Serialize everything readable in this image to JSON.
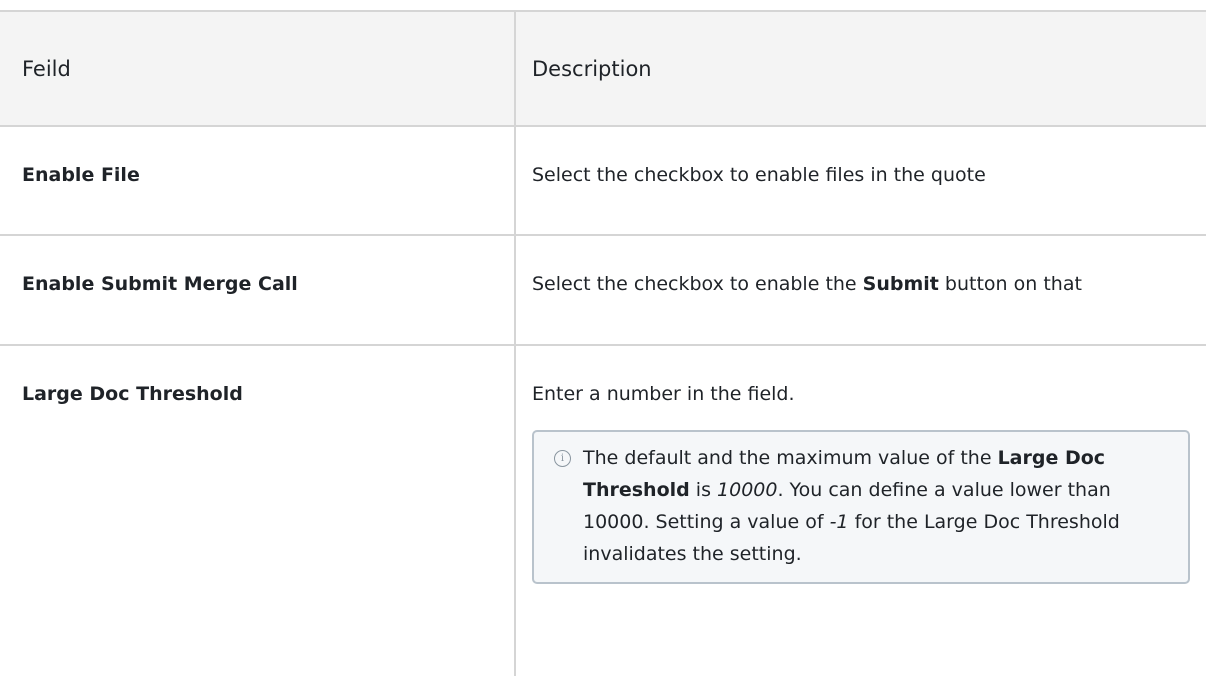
{
  "table": {
    "headers": {
      "field": "Feild",
      "description": "Description"
    },
    "rows": [
      {
        "field": "Enable File",
        "description": "Select the checkbox to enable files in the quote"
      },
      {
        "field": "Enable Submit Merge Call",
        "desc_pre": "Select the checkbox to enable the ",
        "desc_bold": "Submit",
        "desc_post": " button on that"
      },
      {
        "field": "Large Doc Threshold",
        "description": "Enter a number in the field."
      }
    ],
    "note": {
      "icon": "info-icon",
      "t1": "The default and the maximum value of the ",
      "b1": "Large Doc Threshold",
      "t2": " is ",
      "i1": "10000",
      "t3": ". You can define a value lower than 10000. Setting a value of ",
      "i2": "-1",
      "t4": " for the Large Doc Threshold invalidates the setting."
    }
  }
}
